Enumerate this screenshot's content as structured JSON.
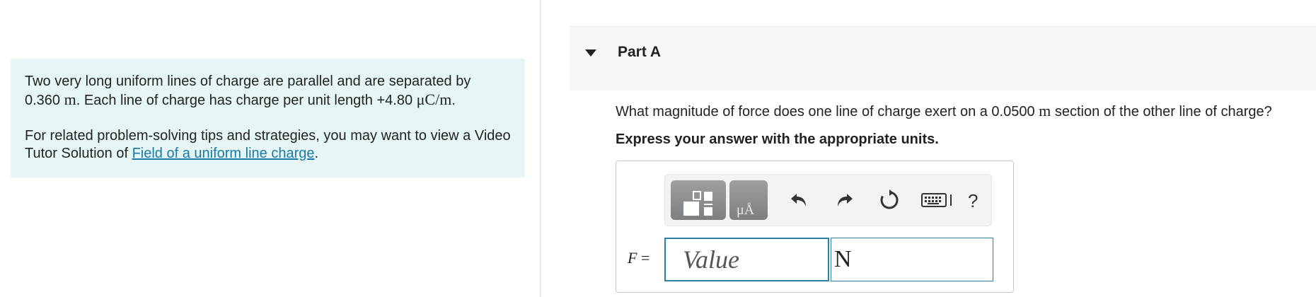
{
  "intro": {
    "line1": "Two very long uniform lines of charge are parallel and are separated by",
    "sep_value": "0.360",
    "sep_unit": "m",
    "line2_mid": ". Each line of charge has charge per unit length +4.80",
    "lambda_unit": "μC/m",
    "line2_end": ".",
    "tips_text": "For related problem-solving tips and strategies, you may want to view a Video Tutor Solution of",
    "tips_link": "Field of a uniform line charge",
    "tips_end": "."
  },
  "part": {
    "title": "Part A"
  },
  "question": {
    "text_before": "What magnitude of force does one line of charge exert on a 0.0500",
    "length_unit": "m",
    "text_after": "section of the other line of charge?",
    "instruction": "Express your answer with the appropriate units."
  },
  "answer": {
    "variable": "F",
    "equals": "=",
    "value_placeholder": "Value",
    "units_value": "N"
  },
  "toolbar": {
    "icons": [
      "templates-icon",
      "units-icon",
      "undo-icon",
      "redo-icon",
      "reset-icon",
      "keyboard-icon",
      "help-icon"
    ],
    "units_label": "μÅ",
    "help_label": "?"
  },
  "colors": {
    "intro_bg": "#e6f6f6",
    "link": "#1a7aa6",
    "input_border": "#2b7ea6",
    "header_bg": "#f6f7f8"
  }
}
